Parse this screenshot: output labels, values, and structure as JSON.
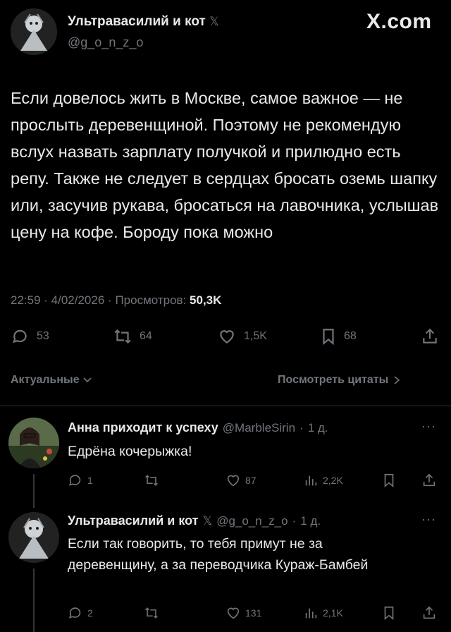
{
  "header": {
    "author_name": "Ультравасилий и кот",
    "x_badge": "𝕏",
    "handle": "@g_o_n_z_o",
    "site_logo": "X.com"
  },
  "tweet": {
    "text": "Если довелось жить в Москве, самое важное — не прослыть деревенщиной. Поэтому не рекомендую вслух назвать зарплату получкой и прилюдно есть репу. Также не следует в сердцах бросать оземь шапку или, засучив рукава, бросаться на лавочника, услышав цену на кофе. Бороду пока можно",
    "time": "22:59",
    "date": "4/02/2026",
    "views_label": "Просмотров:",
    "views_count": "50,3K",
    "actions": {
      "replies": "53",
      "reposts": "64",
      "likes": "1,5K",
      "bookmarks": "68"
    }
  },
  "filters": {
    "sort_label": "Актуальные",
    "quotes_label": "Посмотреть цитаты"
  },
  "replies": [
    {
      "name": "Анна приходит к успеху",
      "handle": "@MarbleSirin",
      "age": "1 д.",
      "text": "Едрёна кочерыжка!",
      "replies": "1",
      "reposts": "",
      "likes": "87",
      "views": "2,2K"
    },
    {
      "name": "Ультравасилий и кот",
      "badge": "𝕏",
      "handle": "@g_o_n_z_o",
      "age": "1 д.",
      "text": "Если так говорить, то тебя примут не за деревенщину, а за переводчика Кураж-Бамбей",
      "replies": "2",
      "reposts": "",
      "likes": "131",
      "views": "2,1K"
    }
  ],
  "icons": {
    "reply": "reply-icon",
    "repost": "repost-icon",
    "like": "heart-icon",
    "bookmark": "bookmark-icon",
    "share": "share-icon",
    "views": "views-icon",
    "more": "more-icon"
  },
  "colors": {
    "background": "#000000",
    "text": "#e7e9ea",
    "muted": "#71767b",
    "separator": "#2f3336"
  }
}
